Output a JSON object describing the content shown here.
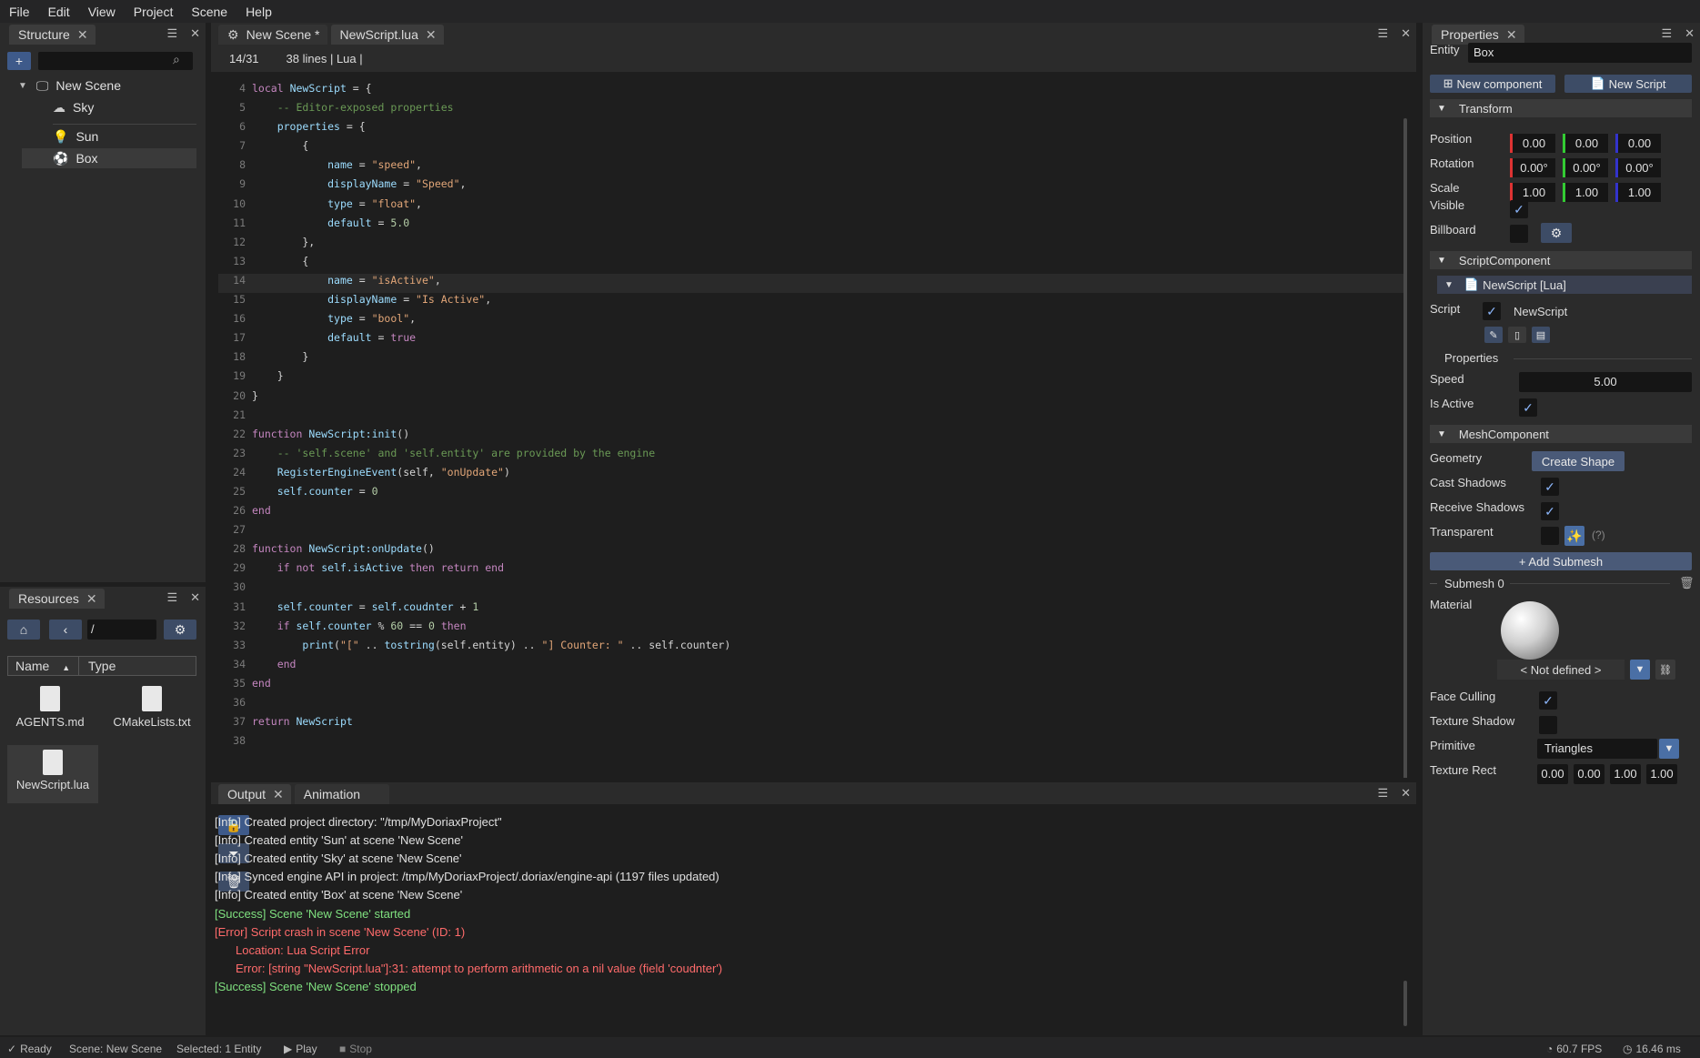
{
  "menu": [
    "File",
    "Edit",
    "View",
    "Project",
    "Scene",
    "Help"
  ],
  "structure": {
    "tab": "Structure",
    "add_label": "+",
    "items": [
      {
        "label": "New Scene"
      },
      {
        "label": "Sky"
      },
      {
        "label": "Sun"
      },
      {
        "label": "Box"
      }
    ]
  },
  "editor": {
    "tabs": [
      "New Scene *",
      "NewScript.lua"
    ],
    "cursor": "14/31",
    "info": "38 lines  | Lua |",
    "lines": [
      {
        "n": "4",
        "html": "<span class='kw'>local</span> <span class='fn'>NewScript</span> = {"
      },
      {
        "n": "5",
        "html": "    <span class='cm'>-- Editor-exposed properties</span>"
      },
      {
        "n": "6",
        "html": "    <span class='fn'>properties</span> = {"
      },
      {
        "n": "7",
        "html": "        {"
      },
      {
        "n": "8",
        "html": "            <span class='fn'>name</span> = <span class='str'>\"speed\"</span>,"
      },
      {
        "n": "9",
        "html": "            <span class='fn'>displayName</span> = <span class='str'>\"Speed\"</span>,"
      },
      {
        "n": "10",
        "html": "            <span class='fn'>type</span> = <span class='str'>\"float\"</span>,"
      },
      {
        "n": "11",
        "html": "            <span class='fn'>default</span> = <span class='num'>5.0</span>"
      },
      {
        "n": "12",
        "html": "        },"
      },
      {
        "n": "13",
        "html": "        {"
      },
      {
        "n": "14",
        "html": "            <span class='fn'>name</span> = <span class='str'>\"isActive\"</span>,"
      },
      {
        "n": "15",
        "html": "            <span class='fn'>displayName</span> = <span class='str'>\"Is Active\"</span>,"
      },
      {
        "n": "16",
        "html": "            <span class='fn'>type</span> = <span class='str'>\"bool\"</span>,"
      },
      {
        "n": "17",
        "html": "            <span class='fn'>default</span> = <span class='bool'>true</span>"
      },
      {
        "n": "18",
        "html": "        }"
      },
      {
        "n": "19",
        "html": "    }"
      },
      {
        "n": "20",
        "html": "}"
      },
      {
        "n": "21",
        "html": ""
      },
      {
        "n": "22",
        "html": "<span class='kw'>function</span> <span class='fn'>NewScript:init</span>()"
      },
      {
        "n": "23",
        "html": "    <span class='cm'>-- 'self.scene' and 'self.entity' are provided by the engine</span>"
      },
      {
        "n": "24",
        "html": "    <span class='fn'>RegisterEngineEvent</span>(self, <span class='str'>\"onUpdate\"</span>)"
      },
      {
        "n": "25",
        "html": "    <span class='fn'>self.counter</span> = <span class='num'>0</span>"
      },
      {
        "n": "26",
        "html": "<span class='kw'>end</span>"
      },
      {
        "n": "27",
        "html": ""
      },
      {
        "n": "28",
        "html": "<span class='kw'>function</span> <span class='fn'>NewScript:onUpdate</span>()"
      },
      {
        "n": "29",
        "html": "    <span class='kw'>if not</span> <span class='fn'>self.isActive</span> <span class='kw'>then return end</span>"
      },
      {
        "n": "30",
        "html": ""
      },
      {
        "n": "31",
        "html": "    <span class='fn'>self.counter</span> = <span class='fn'>self.coudnter</span> + <span class='num'>1</span>"
      },
      {
        "n": "32",
        "html": "    <span class='kw'>if</span> <span class='fn'>self.counter</span> % <span class='num'>60</span> == <span class='num'>0</span> <span class='kw'>then</span>"
      },
      {
        "n": "33",
        "html": "        <span class='fn'>print</span>(<span class='str'>\"[\"</span> .. <span class='fn'>tostring</span>(self.entity) .. <span class='str'>\"] Counter: \"</span> .. self.counter)"
      },
      {
        "n": "34",
        "html": "    <span class='kw'>end</span>"
      },
      {
        "n": "35",
        "html": "<span class='kw'>end</span>"
      },
      {
        "n": "36",
        "html": ""
      },
      {
        "n": "37",
        "html": "<span class='kw'>return</span> <span class='fn'>NewScript</span>"
      },
      {
        "n": "38",
        "html": ""
      }
    ]
  },
  "resources": {
    "tab": "Resources",
    "path": "/",
    "col_name": "Name",
    "col_type": "Type",
    "files": [
      "AGENTS.md",
      "CMakeLists.txt",
      "NewScript.lua"
    ]
  },
  "output": {
    "tabs": [
      "Output",
      "Animation"
    ],
    "lines": [
      {
        "text": "[Info] Created project directory: \"/tmp/MyDoriaxProject\"",
        "kind": "info"
      },
      {
        "text": "[Info] Created entity 'Sun' at scene 'New Scene'",
        "kind": "info"
      },
      {
        "text": "[Info] Created entity 'Sky' at scene 'New Scene'",
        "kind": "info"
      },
      {
        "text": "[Info] Synced engine API in project: /tmp/MyDoriaxProject/.doriax/engine-api (1197 files updated)",
        "kind": "info"
      },
      {
        "text": "[Info] Created entity 'Box' at scene 'New Scene'",
        "kind": "info"
      },
      {
        "text": "[Success] Scene 'New Scene' started",
        "kind": "success"
      },
      {
        "text": "[Error] Script crash in scene 'New Scene' (ID: 1)",
        "kind": "error"
      },
      {
        "text": "Location: Lua Script Error",
        "kind": "error-sub"
      },
      {
        "text": "Error: [string \"NewScript.lua\"]:31: attempt to perform arithmetic on a nil value (field 'coudnter')",
        "kind": "error-sub"
      },
      {
        "text": "[Success] Scene 'New Scene' stopped",
        "kind": "success"
      }
    ]
  },
  "properties": {
    "tab": "Properties",
    "entity_label": "Entity",
    "entity_value": "Box",
    "new_component": "New component",
    "new_script": "New Script",
    "transform": "Transform",
    "position_label": "Position",
    "rotation_label": "Rotation",
    "scale_label": "Scale",
    "visible_label": "Visible",
    "billboard_label": "Billboard",
    "position": [
      "0.00",
      "0.00",
      "0.00"
    ],
    "rotation": [
      "0.00°",
      "0.00°",
      "0.00°"
    ],
    "scale": [
      "1.00",
      "1.00",
      "1.00"
    ],
    "script_component": "ScriptComponent",
    "script_header": "NewScript [Lua]",
    "script_label": "Script",
    "script_name": "NewScript",
    "props_header": "Properties",
    "speed_label": "Speed",
    "speed_value": "5.00",
    "isactive_label": "Is Active",
    "mesh_component": "MeshComponent",
    "geometry_label": "Geometry",
    "create_shape": "Create Shape",
    "cast_shadows": "Cast Shadows",
    "receive_shadows": "Receive Shadows",
    "transparent": "Transparent",
    "help": "(?)",
    "add_submesh": "+ Add Submesh",
    "submesh": "Submesh 0",
    "material_label": "Material",
    "not_defined": "< Not defined >",
    "face_culling": "Face Culling",
    "texture_shadow": "Texture Shadow",
    "primitive_label": "Primitive",
    "primitive_value": "Triangles",
    "texture_rect_label": "Texture Rect",
    "texture_rect": [
      "0.00",
      "0.00",
      "1.00",
      "1.00"
    ]
  },
  "status": {
    "ready": "Ready",
    "scene": "Scene: New Scene",
    "selected": "Selected: 1 Entity",
    "play": "Play",
    "stop": "Stop",
    "fps": "60.7 FPS",
    "ms": "16.46 ms"
  }
}
